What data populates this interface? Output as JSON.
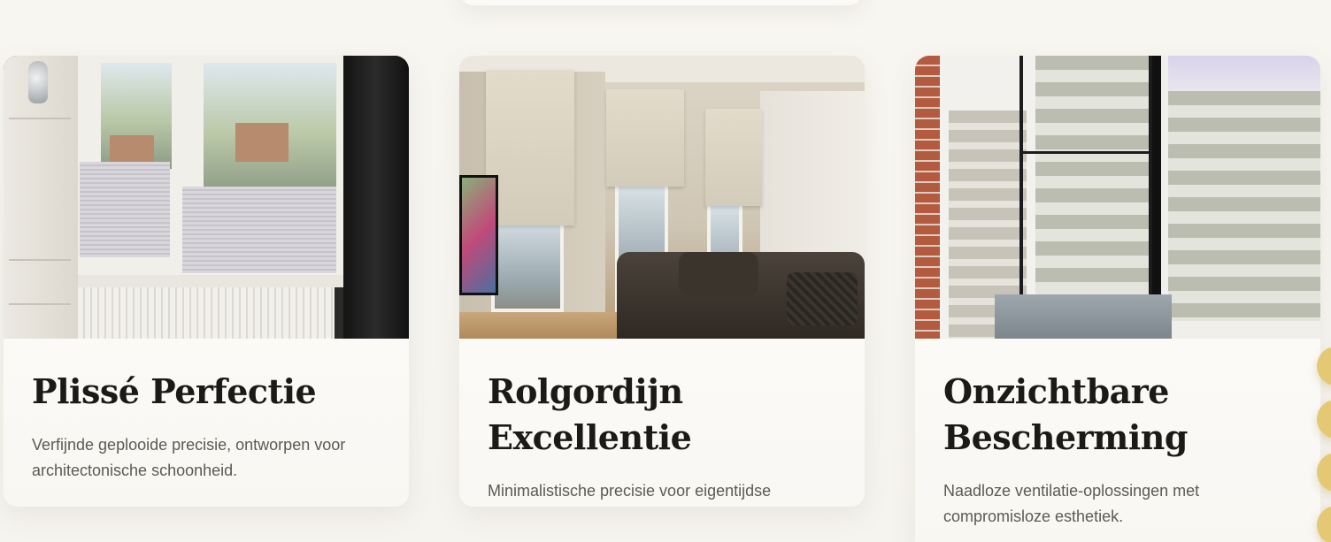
{
  "cards": [
    {
      "title": "Plissé Perfectie",
      "description": "Verfijnde geplooide precisie, ontworpen voor architectonische schoonheid.",
      "image_icon": "plisse-window-photo"
    },
    {
      "title": "Rolgordijn Excellentie",
      "description": "Minimalistische precisie voor eigentijdse interieurwensen.",
      "image_icon": "roller-blind-room-photo"
    },
    {
      "title": "Onzichtbare Bescherming",
      "description": "Naadloze ventilatie-oplossingen met compromisloze esthetiek.",
      "image_icon": "insect-screen-window-photo"
    }
  ],
  "colors": {
    "background": "#f7f5f0",
    "card": "#fbfaf7",
    "title": "#1b1a17",
    "text": "#5d5a55",
    "accent_gold": "#e4c873"
  }
}
